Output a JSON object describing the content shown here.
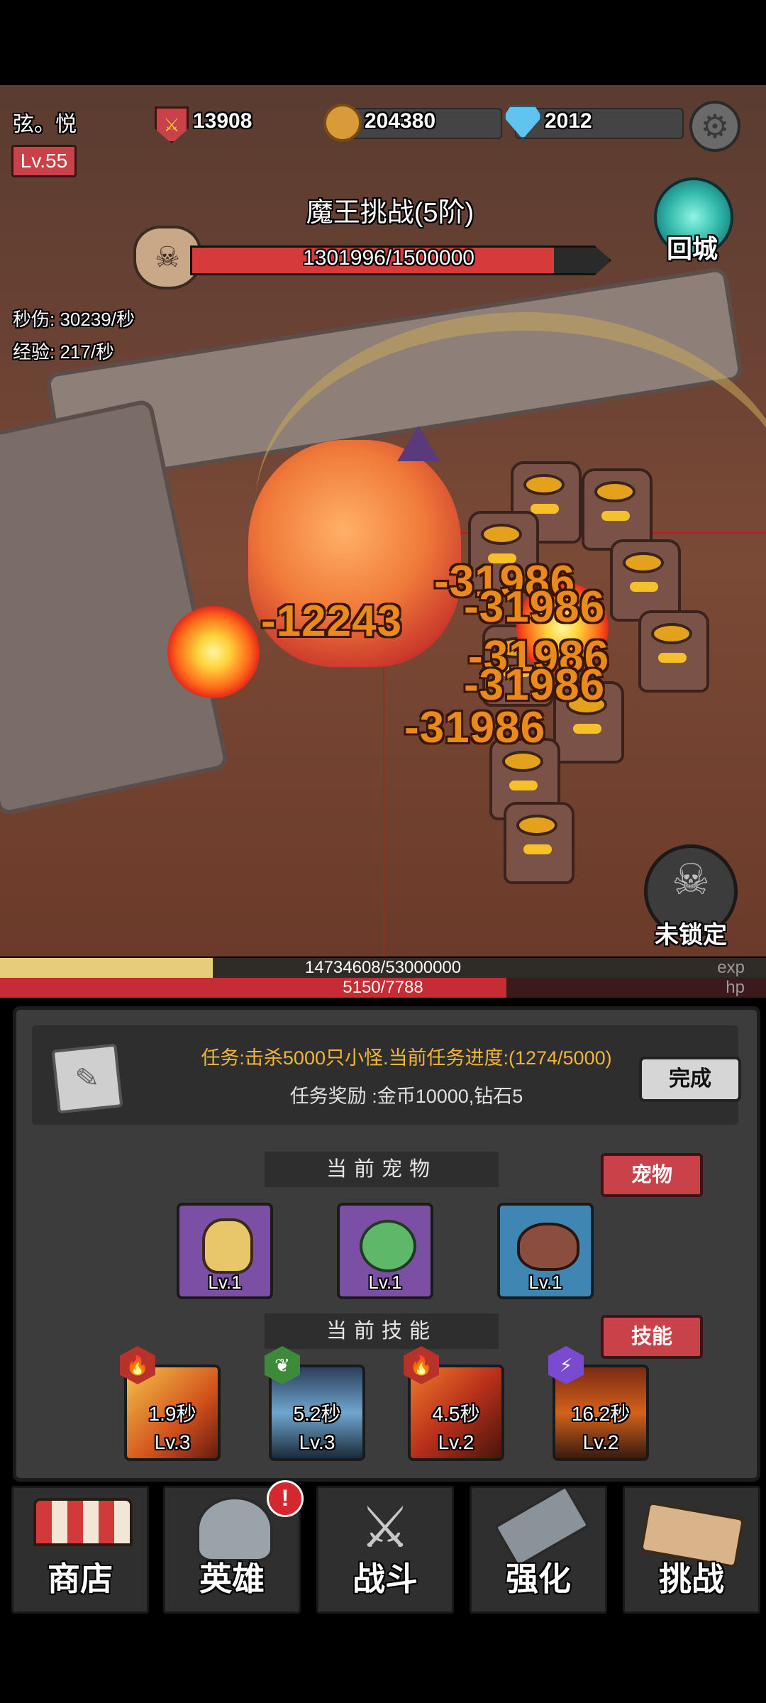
{
  "player": {
    "name": "弦。悦",
    "level": "Lv.55"
  },
  "resources": {
    "power": "13908",
    "gold": "204380",
    "diamond": "2012"
  },
  "boss": {
    "title": "魔王挑战(5阶)",
    "hp_text": "1301996/1500000",
    "hp_current": 1301996,
    "hp_max": 1500000
  },
  "stats": {
    "dps": "秒伤: 30239/秒",
    "exp_rate": "经验: 217/秒"
  },
  "buttons": {
    "return_city": "回城",
    "unlocked": "未锁定"
  },
  "damage_numbers": [
    "-12243",
    "-31986",
    "-31986",
    "-31986",
    "-31986",
    "-31986"
  ],
  "exp": {
    "text": "14734608/53000000",
    "current": 14734608,
    "max": 53000000,
    "tag": "exp"
  },
  "hp": {
    "text": "5150/7788",
    "current": 5150,
    "max": 7788,
    "tag": "hp"
  },
  "task": {
    "description": "任务:击杀5000只小怪.当前任务进度:(1274/5000)",
    "reward": "任务奖励 :金币10000,钻石5",
    "done_label": "完成"
  },
  "pets": {
    "title": "当前宠物",
    "button": "宠物",
    "items": [
      {
        "level": "Lv.1",
        "bg": "#7b4fa3"
      },
      {
        "level": "Lv.1",
        "bg": "#7b4fa3"
      },
      {
        "level": "Lv.1",
        "bg": "#3f86b3"
      }
    ]
  },
  "skills": {
    "title": "当前技能",
    "button": "技能",
    "items": [
      {
        "time": "1.9秒",
        "level": "Lv.3",
        "element": "fire-icon"
      },
      {
        "time": "5.2秒",
        "level": "Lv.3",
        "element": "leaf-icon"
      },
      {
        "time": "4.5秒",
        "level": "Lv.2",
        "element": "fire-icon"
      },
      {
        "time": "16.2秒",
        "level": "Lv.2",
        "element": "lightning-icon"
      }
    ]
  },
  "nav": [
    {
      "label": "商店",
      "icon": "shop-icon"
    },
    {
      "label": "英雄",
      "icon": "helmet-icon",
      "badge": "!"
    },
    {
      "label": "战斗",
      "icon": "swords-icon"
    },
    {
      "label": "强化",
      "icon": "hammer-icon"
    },
    {
      "label": "挑战",
      "icon": "scroll-sword-icon"
    }
  ]
}
